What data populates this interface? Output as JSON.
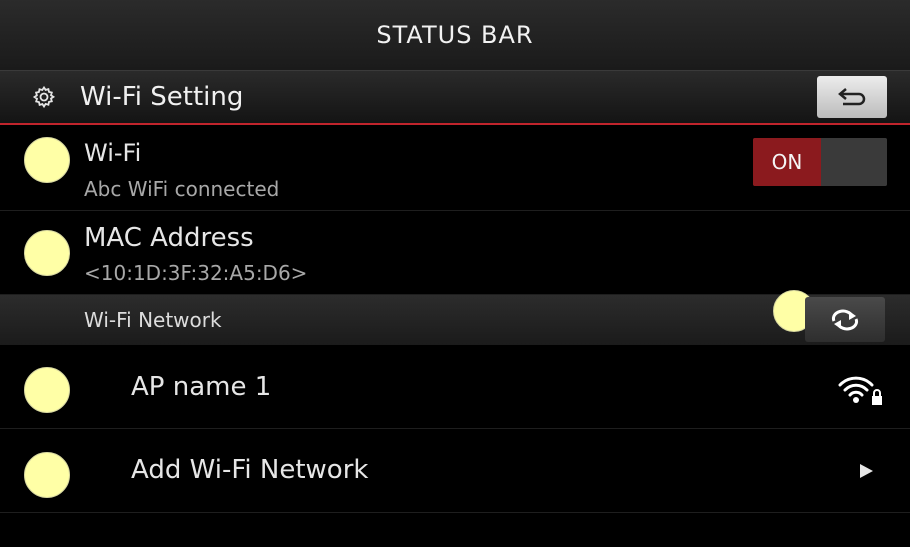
{
  "status_bar": {
    "title": "STATUS BAR"
  },
  "header": {
    "title": "Wi-Fi Setting",
    "icon": "gear-icon",
    "back_icon": "back-arrow-icon"
  },
  "wifi": {
    "label": "Wi-Fi",
    "status": "Abc WiFi connected",
    "toggle_label": "ON",
    "toggle_on": true,
    "toggle_color": "#8b1a1e"
  },
  "mac": {
    "label": "MAC Address",
    "value": "<10:1D:3F:32:A5:D6>"
  },
  "network_section": {
    "label": "Wi-Fi Network",
    "refresh_icon": "refresh-icon"
  },
  "networks": [
    {
      "name": "AP name 1",
      "icon": "wifi-locked-icon"
    }
  ],
  "add_network": {
    "label": "Add Wi-Fi Network",
    "icon": "chevron-right-icon"
  },
  "colors": {
    "accent": "#c0242c",
    "marker": "#ffffa6"
  }
}
